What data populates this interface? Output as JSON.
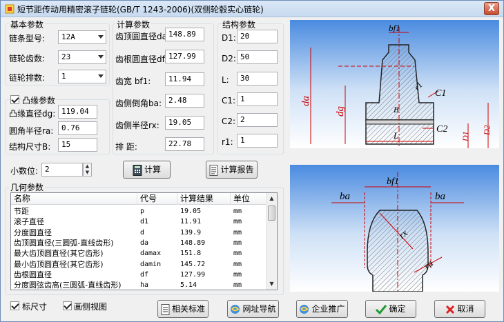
{
  "window": {
    "title": "短节距传动用精密滚子链轮(GB/T 1243-2006)(双侧轮毂实心链轮)",
    "close_label": "X"
  },
  "basic": {
    "title": "基本参数",
    "chain_model_label": "链条型号:",
    "chain_model_value": "12A",
    "teeth_label": "链轮齿数:",
    "teeth_value": "23",
    "rows_label": "链轮排数:",
    "rows_value": "1"
  },
  "boss": {
    "title": "凸缘参数",
    "dg_label": "凸缘直径dg:",
    "dg_value": "119.04",
    "ra_label": "圆角半径ra:",
    "ra_value": "0.76",
    "b_label": "结构尺寸B:",
    "b_value": "15"
  },
  "calc": {
    "title": "计算参数",
    "da_label": "齿顶圆直径da:",
    "da_value": "148.89",
    "df_label": "齿根圆直径df:",
    "df_value": "127.99",
    "bf1_label": "齿宽  bf1:",
    "bf1_value": "11.94",
    "ba_label": "齿侧倒角ba:",
    "ba_value": "2.48",
    "rx_label": "齿侧半径rx:",
    "rx_value": "19.05",
    "pitch_label": "排    距:",
    "pitch_value": "22.78"
  },
  "struct": {
    "title": "结构参数",
    "d1_label": "D1:",
    "d1_value": "20",
    "d2_label": "D2:",
    "d2_value": "50",
    "l_label": "L:",
    "l_value": "30",
    "c1_label": "C1:",
    "c1_value": "1",
    "c2_label": "C2:",
    "c2_value": "2",
    "r1_label": "r1:",
    "r1_value": "1"
  },
  "decimals": {
    "label": "小数位:",
    "value": "2"
  },
  "buttons": {
    "calc": "计算",
    "report": "计算报告",
    "standard": "相关标准",
    "nav": "网址导航",
    "promo": "企业推广",
    "ok": "确定",
    "cancel": "取消"
  },
  "geometry": {
    "title": "几何参数",
    "columns": [
      "名称",
      "代号",
      "计算结果",
      "单位"
    ],
    "rows": [
      {
        "name": "节距",
        "code": "p",
        "value": "19.05",
        "unit": "mm"
      },
      {
        "name": "滚子直径",
        "code": "d1",
        "value": "11.91",
        "unit": "mm"
      },
      {
        "name": "分度圆直径",
        "code": "d",
        "value": "139.9",
        "unit": "mm"
      },
      {
        "name": "齿顶圆直径(三圆弧-直线齿形)",
        "code": "da",
        "value": "148.89",
        "unit": "mm"
      },
      {
        "name": "最大齿顶圆直径(其它齿形)",
        "code": "damax",
        "value": "151.8",
        "unit": "mm"
      },
      {
        "name": "最小齿顶圆直径(其它齿形)",
        "code": "damin",
        "value": "145.72",
        "unit": "mm"
      },
      {
        "name": "齿根圆直径",
        "code": "df",
        "value": "127.99",
        "unit": "mm"
      },
      {
        "name": "分度圆弦齿高(三圆弧-直线齿形)",
        "code": "ha",
        "value": "5.14",
        "unit": "mm"
      }
    ]
  },
  "options": {
    "dim_label": "标尺寸",
    "side_view_label": "画侧视图"
  },
  "figure1": {
    "bf1": "bf1",
    "r1": "r1",
    "c1": "C1",
    "c2": "C2",
    "da": "da",
    "dg": "dg",
    "b": "B",
    "l": "L",
    "d1": "D1",
    "d2": "D2"
  },
  "figure2": {
    "bf1": "bf1",
    "ba_left": "ba",
    "ba_right": "ba",
    "rx": "rx",
    "ra": "ra"
  },
  "colors": {
    "accent_red": "#cc0000",
    "figure_bg_top": "#4a8be0",
    "figure_bg_bottom": "#ffffff",
    "hatch": "#a9a9a9"
  }
}
